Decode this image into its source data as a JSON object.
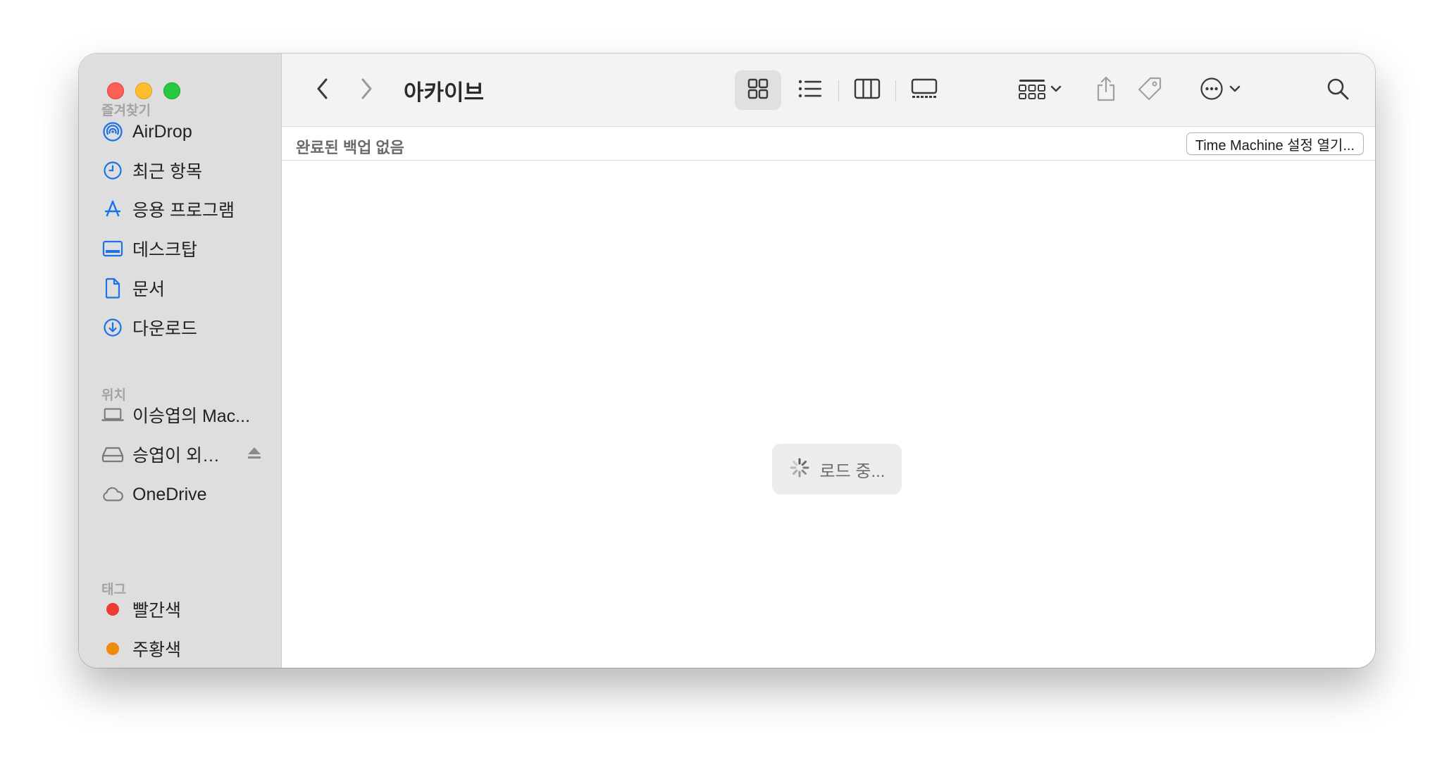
{
  "window": {
    "title": "아카이브"
  },
  "sidebar": {
    "favorites_header": "즐겨찾기",
    "favorites": [
      {
        "label": "AirDrop",
        "icon": "airdrop-icon"
      },
      {
        "label": "최근 항목",
        "icon": "clock-icon"
      },
      {
        "label": "응용 프로그램",
        "icon": "applications-icon"
      },
      {
        "label": "데스크탑",
        "icon": "desktop-icon"
      },
      {
        "label": "문서",
        "icon": "document-icon"
      },
      {
        "label": "다운로드",
        "icon": "download-icon"
      }
    ],
    "locations_header": "위치",
    "locations": [
      {
        "label": "이승엽의 Mac...",
        "icon": "laptop-icon"
      },
      {
        "label": "승엽이 외…",
        "icon": "external-drive-icon"
      },
      {
        "label": "OneDrive",
        "icon": "cloud-icon"
      }
    ],
    "tags_header": "태그",
    "tags": [
      {
        "label": "빨간색",
        "color": "#ee3b30"
      },
      {
        "label": "주황색",
        "color": "#f08a0f"
      }
    ]
  },
  "infobar": {
    "status": "완료된 백업 없음",
    "time_machine_button": "Time Machine 설정 열기..."
  },
  "content": {
    "loading_text": "로드 중..."
  },
  "colors": {
    "accent": "#1a73e8",
    "sidebar_bg": "#dedede"
  }
}
